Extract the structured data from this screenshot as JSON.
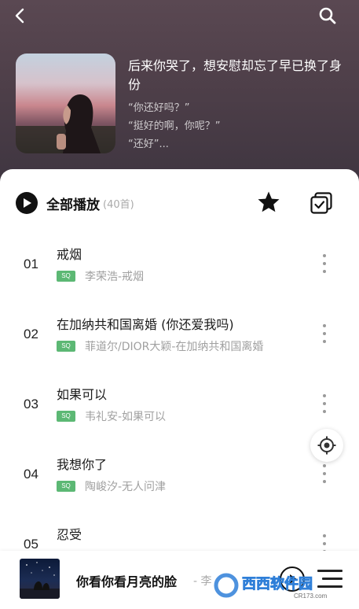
{
  "header": {
    "back_icon": "back-arrow-icon",
    "search_icon": "search-icon",
    "playlist": {
      "title": "后来你哭了，想安慰却忘了早已换了身份",
      "lines": [
        "“你还好吗？”",
        "“挺好的啊，你呢？”",
        "“还好”..."
      ]
    }
  },
  "toolbar": {
    "play_all_label": "全部播放",
    "count": "(40首)",
    "star_icon": "star-icon",
    "multi_select_icon": "multi-select-icon"
  },
  "songs": [
    {
      "index": "01",
      "title": "戒烟",
      "quality": "SQ",
      "subtitle": "李荣浩-戒烟"
    },
    {
      "index": "02",
      "title": "在加纳共和国离婚 (你还爱我吗)",
      "quality": "SQ",
      "subtitle": "菲道尔/DIOR大颖-在加纳共和国离婚"
    },
    {
      "index": "03",
      "title": "如果可以",
      "quality": "SQ",
      "subtitle": "韦礼安-如果可以"
    },
    {
      "index": "04",
      "title": "我想你了",
      "quality": "SQ",
      "subtitle": "陶峻汐-无人问津"
    },
    {
      "index": "05",
      "title": "忍受",
      "quality": "",
      "subtitle": ""
    }
  ],
  "mini_player": {
    "title": "你看你看月亮的脸",
    "artist": "- 李",
    "play_icon": "play-icon",
    "playlist_icon": "playlist-icon"
  },
  "watermark": {
    "text": "西西软件园",
    "url": "CR173.com"
  },
  "colors": {
    "header_bg": "#4e3f49",
    "sq_badge": "#5cb874",
    "secondary_text": "#a0a0a0"
  }
}
